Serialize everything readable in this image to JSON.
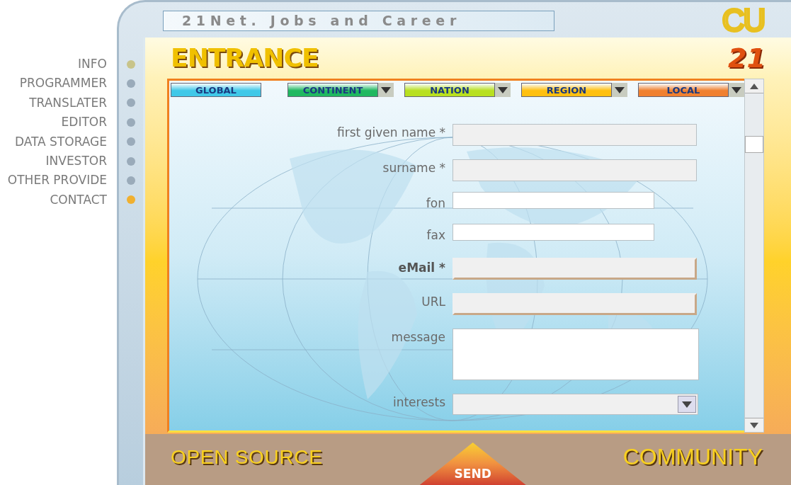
{
  "site_title": "21Net. Jobs and Career",
  "logo": "CU",
  "heading": "ENTRANCE",
  "badge": "21",
  "sidebar": {
    "items": [
      {
        "label": "INFO",
        "color": "#c8c48a"
      },
      {
        "label": "PROGRAMMER",
        "color": "#9aabba"
      },
      {
        "label": "TRANSLATER",
        "color": "#9aabba"
      },
      {
        "label": "EDITOR",
        "color": "#9aabba"
      },
      {
        "label": "DATA STORAGE",
        "color": "#9aabba"
      },
      {
        "label": "INVESTOR",
        "color": "#9aabba"
      },
      {
        "label": "OTHER PROVIDE",
        "color": "#9aabba"
      },
      {
        "label": "CONTACT",
        "color": "#f0b030"
      }
    ]
  },
  "tabs": [
    {
      "label": "GLOBAL",
      "color": "#40c8e8",
      "dropdown": false
    },
    {
      "label": "CONTINENT",
      "color": "#20b860",
      "dropdown": true
    },
    {
      "label": "NATION",
      "color": "#b8e020",
      "dropdown": true
    },
    {
      "label": "REGION",
      "color": "#ffc010",
      "dropdown": true
    },
    {
      "label": "LOCAL",
      "color": "#f08030",
      "dropdown": true
    }
  ],
  "form": {
    "fields": [
      {
        "label": "first given name *",
        "kind": "text",
        "bold": false,
        "highlighted": false
      },
      {
        "label": "surname *",
        "kind": "text",
        "bold": false,
        "highlighted": false
      },
      {
        "label": "fon",
        "kind": "short",
        "bold": false,
        "highlighted": false
      },
      {
        "label": "fax",
        "kind": "short",
        "bold": false,
        "highlighted": false
      },
      {
        "label": "eMail *",
        "kind": "text",
        "bold": true,
        "highlighted": true
      },
      {
        "label": "URL",
        "kind": "text",
        "bold": false,
        "highlighted": true
      },
      {
        "label": "message",
        "kind": "textarea",
        "bold": false,
        "highlighted": false
      },
      {
        "label": "interests",
        "kind": "select",
        "bold": false,
        "highlighted": false
      }
    ]
  },
  "footer": {
    "left": "OPEN SOURCE",
    "button": "SEND",
    "right": "COMMUNITY"
  }
}
